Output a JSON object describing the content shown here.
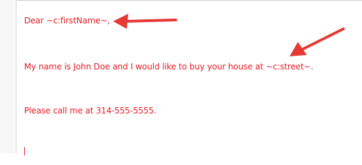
{
  "letter": {
    "greeting": "Dear ~c:firstName~,",
    "body": "My name is John Doe and I would like to buy your house at ~c:street~.",
    "closing": "Please call me at 314-555-5555."
  },
  "colors": {
    "text": "#e31c25",
    "annotation_arrow": "#e53935"
  },
  "annotations": [
    {
      "icon": "arrow-left-icon",
      "points_to": "~c:firstName~"
    },
    {
      "icon": "arrow-down-left-icon",
      "points_to": "~c:street~"
    }
  ]
}
